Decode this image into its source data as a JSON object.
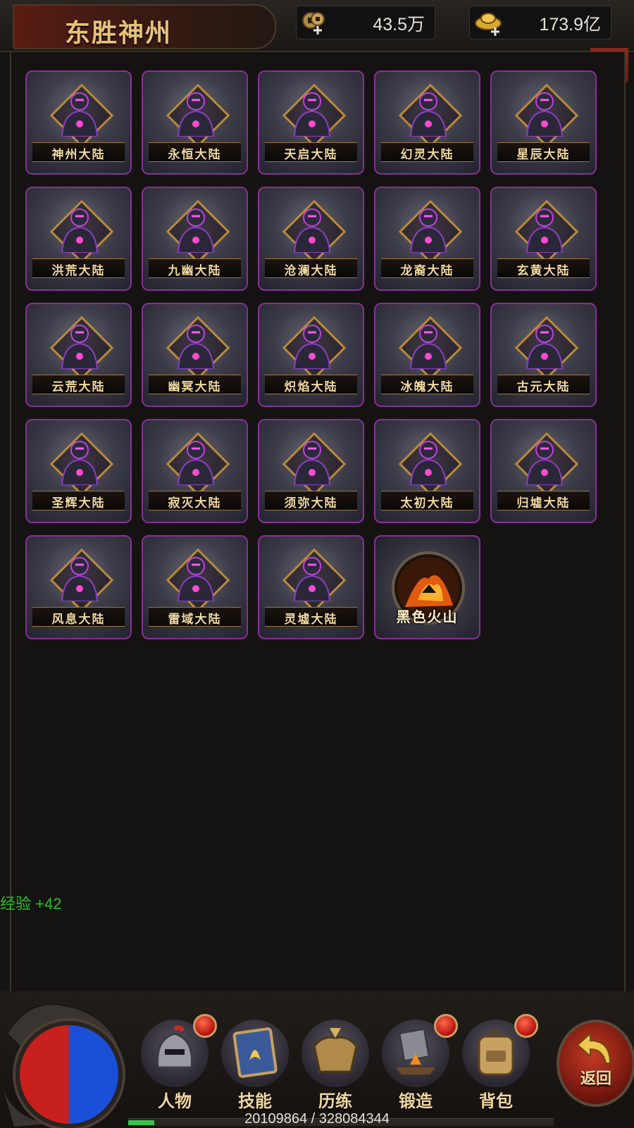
{
  "header": {
    "title": "东胜神州",
    "copper": {
      "icon": "copper-coin-add-icon",
      "value": "43.5万"
    },
    "gold": {
      "icon": "gold-ingot-add-icon",
      "value": "173.9亿"
    },
    "close": {
      "icon": "close-icon",
      "glyph": "✕"
    }
  },
  "maps": [
    {
      "label": "神州大陆",
      "icon": "hero-portrait-icon"
    },
    {
      "label": "永恒大陆",
      "icon": "hero-portrait-icon"
    },
    {
      "label": "天启大陆",
      "icon": "hero-portrait-icon"
    },
    {
      "label": "幻灵大陆",
      "icon": "hero-portrait-icon"
    },
    {
      "label": "星辰大陆",
      "icon": "hero-portrait-icon"
    },
    {
      "label": "洪荒大陆",
      "icon": "hero-portrait-icon"
    },
    {
      "label": "九幽大陆",
      "icon": "hero-portrait-icon"
    },
    {
      "label": "沧澜大陆",
      "icon": "hero-portrait-icon"
    },
    {
      "label": "龙裔大陆",
      "icon": "hero-portrait-icon"
    },
    {
      "label": "玄黄大陆",
      "icon": "hero-portrait-icon"
    },
    {
      "label": "云荒大陆",
      "icon": "hero-portrait-icon"
    },
    {
      "label": "幽冥大陆",
      "icon": "hero-portrait-icon"
    },
    {
      "label": "炽焰大陆",
      "icon": "hero-portrait-icon"
    },
    {
      "label": "冰魄大陆",
      "icon": "hero-portrait-icon"
    },
    {
      "label": "古元大陆",
      "icon": "hero-portrait-icon"
    },
    {
      "label": "圣辉大陆",
      "icon": "hero-portrait-icon"
    },
    {
      "label": "寂灭大陆",
      "icon": "hero-portrait-icon"
    },
    {
      "label": "须弥大陆",
      "icon": "hero-portrait-icon"
    },
    {
      "label": "太初大陆",
      "icon": "hero-portrait-icon"
    },
    {
      "label": "归墟大陆",
      "icon": "hero-portrait-icon"
    },
    {
      "label": "风息大陆",
      "icon": "hero-portrait-icon"
    },
    {
      "label": "雷域大陆",
      "icon": "hero-portrait-icon"
    },
    {
      "label": "灵墟大陆",
      "icon": "hero-portrait-icon"
    }
  ],
  "special_map": {
    "label": "黑色火山",
    "icon": "volcano-icon"
  },
  "log": {
    "exp_gain": "经验 +42"
  },
  "bottom_nav": {
    "items": [
      {
        "label": "人物",
        "icon": "character-helmet-icon",
        "badge": true
      },
      {
        "label": "技能",
        "icon": "skill-book-icon",
        "badge": false
      },
      {
        "label": "历练",
        "icon": "armor-trial-icon",
        "badge": false
      },
      {
        "label": "锻造",
        "icon": "forge-anvil-icon",
        "badge": true
      },
      {
        "label": "背包",
        "icon": "backpack-icon",
        "badge": true
      }
    ],
    "return_label": "返回",
    "return_icon": "return-arrow-icon",
    "yinyang_icon": "yin-yang-orb-icon"
  },
  "exp": {
    "text": "20109864 / 328084344",
    "current": 20109864,
    "max": 328084344
  },
  "colors": {
    "tile_border": "#8a2f9a",
    "gold_text": "#f1d9a0",
    "exp_green": "#22c02a",
    "badge_red": "#b31010"
  }
}
